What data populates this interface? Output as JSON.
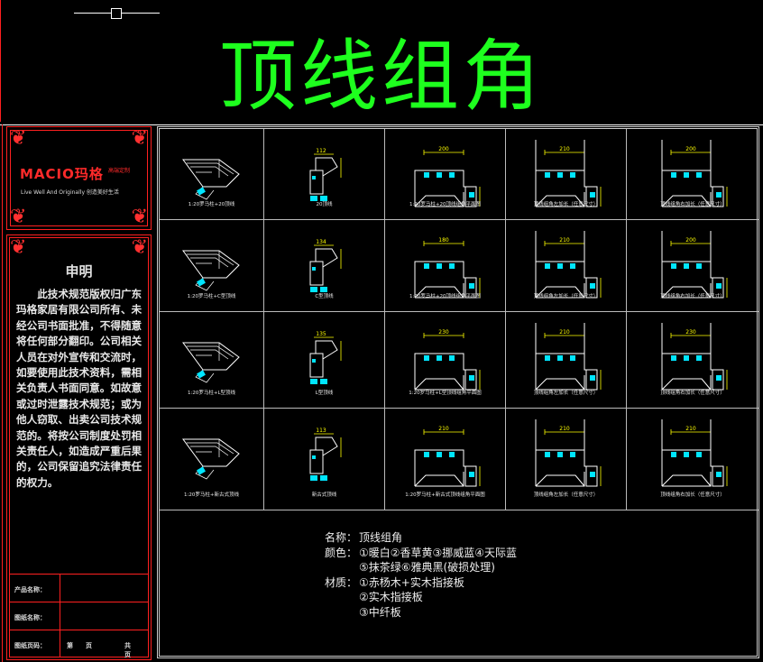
{
  "title": "顶线组角",
  "logo": {
    "brand": "MACIO玛格",
    "brand_sub": "高端定制",
    "slogan": "Live Well And Originally 创造美好生活"
  },
  "declaration": {
    "title": "申明",
    "body": "此技术规范版权归广东玛格家居有限公司所有、未经公司书面批准，不得随意将任何部分翻印。公司相关人员在对外宣传和交流时，如要使用此技术资料，需相关负责人书面同意。如故意或过时泄露技术规范；或为他人窃取、出卖公司技术规范的。将按公司制度处罚相关责任人，如造成严重后果的，公司保留追究法律责任的权力。"
  },
  "info": {
    "product_label": "产品名称：",
    "drawing_label": "图纸名称：",
    "page_label": "图纸页码：",
    "page_a": "第　　页",
    "page_b": "共　　页"
  },
  "rows": [
    {
      "captions": [
        "1:20罗马柱+20顶线",
        "20顶线",
        "1:20罗马柱+20顶线组角平面图",
        "顶线组角左加长（任意尺寸）",
        "顶线组角右加长（任意尺寸）"
      ],
      "dims": [
        "112",
        "200",
        "210",
        "200"
      ]
    },
    {
      "captions": [
        "1:20罗马柱+C型顶线",
        "C型顶线",
        "1:20罗马柱+20顶线组角平面图",
        "顶线组角左加长（任意尺寸）",
        "顶线组角右加长（任意尺寸）"
      ],
      "dims": [
        "134",
        "180",
        "210",
        "200"
      ]
    },
    {
      "captions": [
        "1:20罗马柱+L型顶线",
        "L型顶线",
        "1:20罗马柱+L型顶线组角平面图",
        "顶线组角左加长（任意尺寸）",
        "顶线组角右加长（任意尺寸）"
      ],
      "dims": [
        "135",
        "230",
        "210",
        "230"
      ]
    },
    {
      "captions": [
        "1:20罗马柱+新古式顶线",
        "新古式顶线",
        "1:20罗马柱+新古式顶线组角平面图",
        "顶线组角左加长（任意尺寸）",
        "顶线组角右加长（任意尺寸）"
      ],
      "dims": [
        "113",
        "210",
        "210",
        "210"
      ]
    }
  ],
  "spec": {
    "name_key": "名称：",
    "name_val": "顶线组角",
    "color_key": "颜色：",
    "color_val1": "①暖白②香草黄③挪威蓝④天际蓝",
    "color_val2": "⑤抹茶绿⑥雅典黑(破损处理)",
    "material_key": "材质：",
    "material_val1": "①赤杨木+实木指接板",
    "material_val2": "②实木指接板",
    "material_val3": "③中纤板"
  },
  "colors": {
    "title": "#1eff1e",
    "frame": "#ff2020",
    "dim": "#ffff00",
    "cyan": "#00e5ff"
  }
}
